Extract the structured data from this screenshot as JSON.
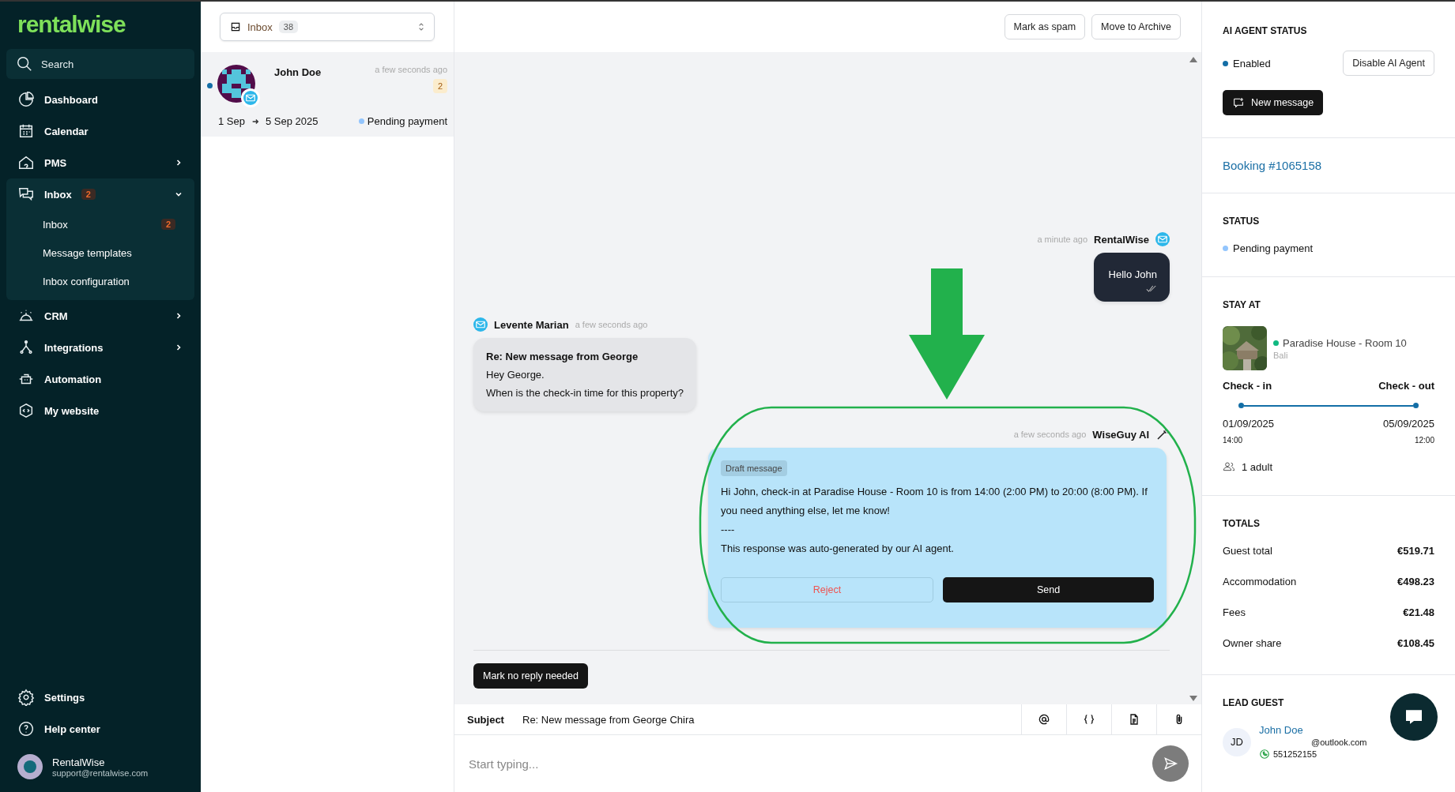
{
  "sidebar": {
    "logo": "rentalwise",
    "search": {
      "placeholder": "Search"
    },
    "items": [
      {
        "label": "Dashboard"
      },
      {
        "label": "Calendar"
      },
      {
        "label": "PMS",
        "expanded": false
      },
      {
        "label": "Inbox",
        "badge": "2",
        "expanded": true,
        "children": [
          {
            "label": "Inbox",
            "badge": "2"
          },
          {
            "label": "Message templates"
          },
          {
            "label": "Inbox configuration"
          }
        ]
      },
      {
        "label": "CRM",
        "expanded": false
      },
      {
        "label": "Integrations",
        "expanded": false
      },
      {
        "label": "Automation"
      },
      {
        "label": "My website"
      }
    ],
    "footer_items": [
      {
        "label": "Settings"
      },
      {
        "label": "Help center"
      }
    ],
    "account": {
      "name": "RentalWise",
      "email": "support@rentalwise.com"
    }
  },
  "folder_select": {
    "label": "Inbox",
    "count": "38"
  },
  "conversations": [
    {
      "name": "John Doe",
      "time": "a few seconds ago",
      "unread_count": "2",
      "unread": true,
      "selected": true,
      "from": "1 Sep",
      "to": "5 Sep 2025",
      "status": "Pending payment",
      "color": "#93c5fd"
    }
  ],
  "header_actions": [
    "Mark as spam",
    "Move to Archive"
  ],
  "messages": [
    {
      "kind": "outgoing",
      "time": "a minute ago",
      "author": "RentalWise",
      "text": "Hello John"
    },
    {
      "kind": "incoming",
      "time": "a few seconds ago",
      "author": "Levente Marian",
      "subject": "Re: New message from George",
      "lines": [
        "Hey George.",
        "When is the check-in time for this property?"
      ]
    },
    {
      "kind": "draft",
      "time": "a few seconds ago",
      "author": "WiseGuy AI",
      "tag": "Draft message",
      "lines": [
        "Hi John, check-in at Paradise House - Room 10 is from 14:00 (2:00 PM) to 20:00 (8:00 PM). If you need anything else, let me know!",
        "----",
        "This response was auto-generated by our AI agent."
      ],
      "reject": "Reject",
      "send": "Send"
    }
  ],
  "mark_no_reply": "Mark no reply needed",
  "composer": {
    "subject_label": "Subject",
    "subject": "Re: New message from George Chira",
    "placeholder": "Start typing..."
  },
  "details": {
    "ai_agent": {
      "title": "AI AGENT STATUS",
      "status": "Enabled",
      "enabled": true,
      "toggle": "Disable AI Agent",
      "new_message": "New message"
    },
    "booking": "Booking #1065158",
    "status": {
      "title": "STATUS",
      "value": "Pending payment",
      "color": "#93c5fd"
    },
    "stay": {
      "title": "STAY AT",
      "property": "Paradise House - Room 10",
      "location": "Bali",
      "checkin_label": "Check - in",
      "checkout_label": "Check - out",
      "checkin_date": "01/09/2025",
      "checkin_time": "14:00",
      "checkout_date": "05/09/2025",
      "checkout_time": "12:00",
      "guests": "1 adult"
    },
    "totals": {
      "title": "TOTALS",
      "rows": [
        {
          "label": "Guest total",
          "value": "€519.71"
        },
        {
          "label": "Accommodation",
          "value": "€498.23"
        },
        {
          "label": "Fees",
          "value": "€21.48"
        },
        {
          "label": "Owner share",
          "value": "€108.45"
        }
      ]
    },
    "lead_guest": {
      "title": "LEAD GUEST",
      "initials": "JD",
      "name": "John Doe",
      "email": "@outlook.com",
      "phone": "551252155"
    }
  }
}
